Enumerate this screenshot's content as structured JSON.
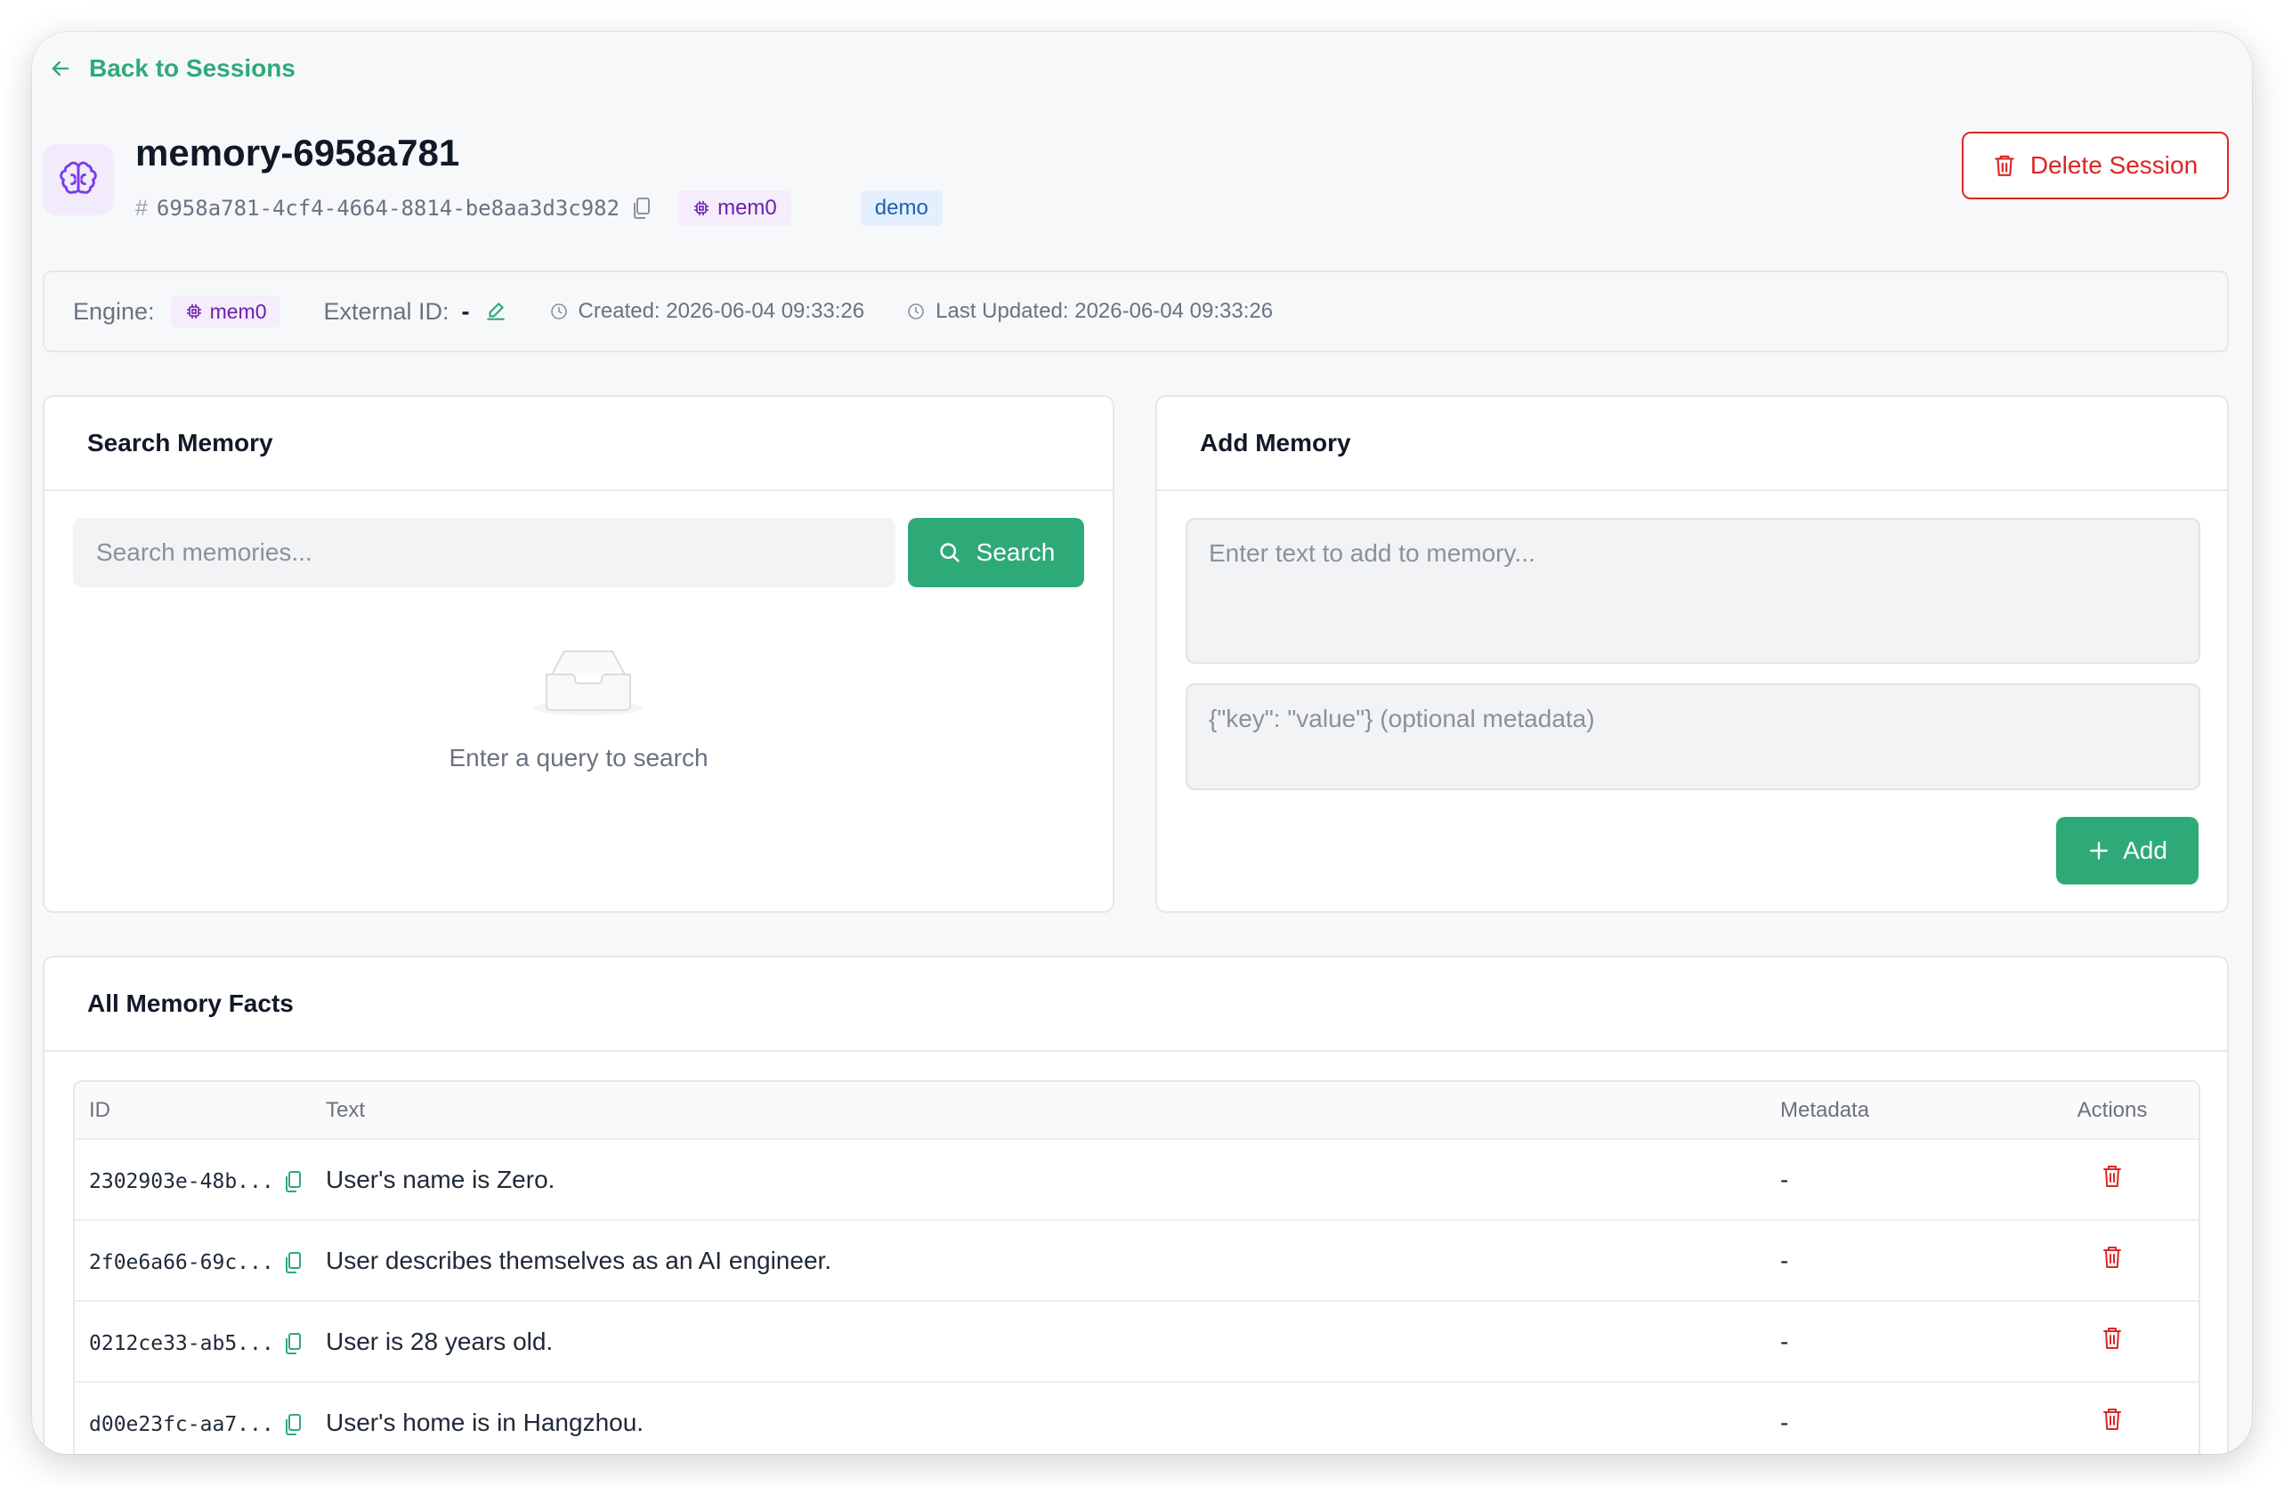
{
  "nav": {
    "back_label": "Back to Sessions"
  },
  "session": {
    "title": "memory-6958a781",
    "hash_symbol": "#",
    "id": "6958a781-4cf4-4664-8814-be8aa3d3c982",
    "engine_tag": "mem0",
    "tag_demo": "demo",
    "delete_label": "Delete Session"
  },
  "info": {
    "engine_label": "Engine:",
    "engine_value": "mem0",
    "external_id_label": "External ID:",
    "external_id_value": "-",
    "created": "Created: 2026-06-04 09:33:26",
    "last_updated": "Last Updated: 2026-06-04 09:33:26"
  },
  "search": {
    "title": "Search Memory",
    "placeholder": "Search memories...",
    "button_label": "Search",
    "empty_text": "Enter a query to search"
  },
  "add": {
    "title": "Add Memory",
    "text_placeholder": "Enter text to add to memory...",
    "metadata_placeholder": "{\"key\": \"value\"} (optional metadata)",
    "button_label": "Add"
  },
  "facts": {
    "title": "All Memory Facts",
    "columns": {
      "id": "ID",
      "text": "Text",
      "metadata": "Metadata",
      "actions": "Actions"
    },
    "rows": [
      {
        "id": "2302903e-48b...",
        "text": "User's name is Zero.",
        "metadata": "-"
      },
      {
        "id": "2f0e6a66-69c...",
        "text": "User describes themselves as an AI engineer.",
        "metadata": "-"
      },
      {
        "id": "0212ce33-ab5...",
        "text": "User is 28 years old.",
        "metadata": "-"
      },
      {
        "id": "d00e23fc-aa7...",
        "text": "User's home is in Hangzhou.",
        "metadata": "-"
      }
    ]
  },
  "colors": {
    "accent_green": "#2eaa78",
    "danger_red": "#dc2626",
    "engine_purple": "#6b21a8",
    "demo_blue": "#1d5fb0"
  },
  "icons": {
    "back": "arrow-left-icon",
    "brain": "brain-icon",
    "copy": "copy-icon",
    "chip": "chip-icon",
    "trash": "trash-icon",
    "edit": "edit-icon",
    "clock": "clock-icon",
    "search": "search-icon",
    "empty": "empty-inbox-icon",
    "plus": "plus-icon"
  }
}
